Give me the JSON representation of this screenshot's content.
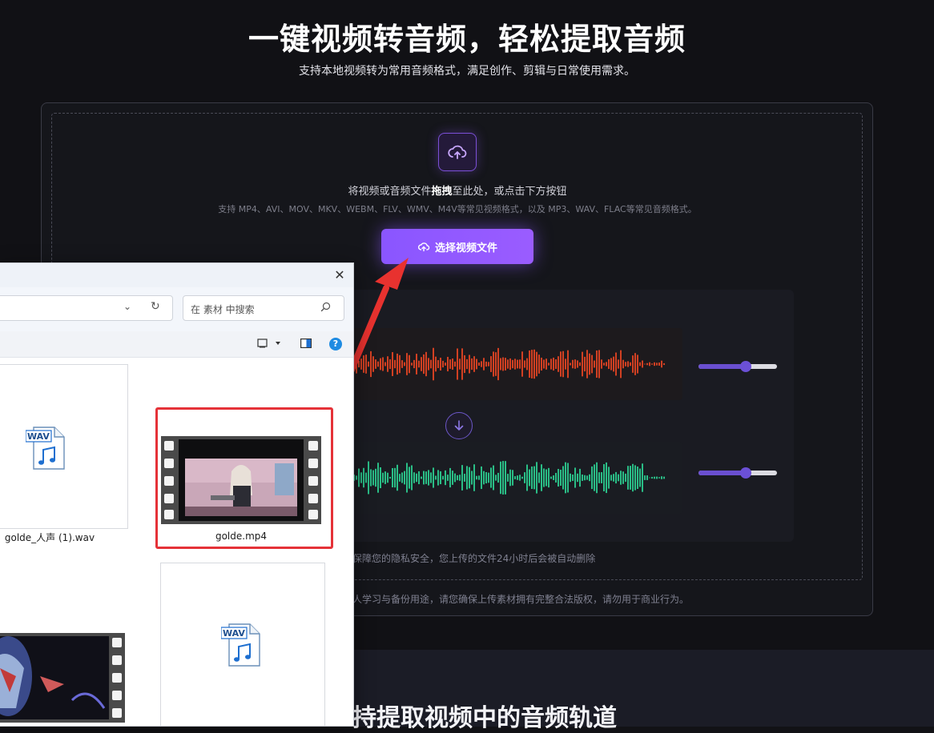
{
  "hero": {
    "title": "一键视频转音频，轻松提取音频",
    "subtitle": "支持本地视频转为常用音频格式，满足创作、剪辑与日常使用需求。"
  },
  "upload": {
    "drop_text_prefix": "将视频或音频文件",
    "drop_text_bold": "拖拽",
    "drop_text_suffix": "至此处，或点击下方按钮",
    "formats": "支持 MP4、AVI、MOV、MKV、WEBM、FLV、WMV、M4V等常见视频格式，以及 MP3、WAV、FLAC等常见音频格式。",
    "button_label": "选择视频文件",
    "privacy": "保障您的隐私安全，您上传的文件24小时后会被自动删除",
    "legal": "人学习与备份用途，请您确保上传素材拥有完整合法版权，请勿用于商业行为。"
  },
  "sliders": {
    "top_value": 0.6,
    "bottom_value": 0.6
  },
  "section": {
    "title": "持提取视频中的音频轨道"
  },
  "dialog": {
    "search_placeholder": "在 素材 中搜索",
    "help_glyph": "?",
    "close_glyph": "✕",
    "files": [
      {
        "name": "golde_人声 (1).wav",
        "type": "wav",
        "badge": "WAV"
      },
      {
        "name": "golde.mp4",
        "type": "video"
      },
      {
        "name": "",
        "type": "video"
      },
      {
        "name": "",
        "type": "wav",
        "badge": "WAV"
      }
    ]
  },
  "colors": {
    "accent": "#8a56ff",
    "wave_red": "#ff4a24",
    "wave_green": "#2ee6a0",
    "highlight": "#e53238"
  }
}
